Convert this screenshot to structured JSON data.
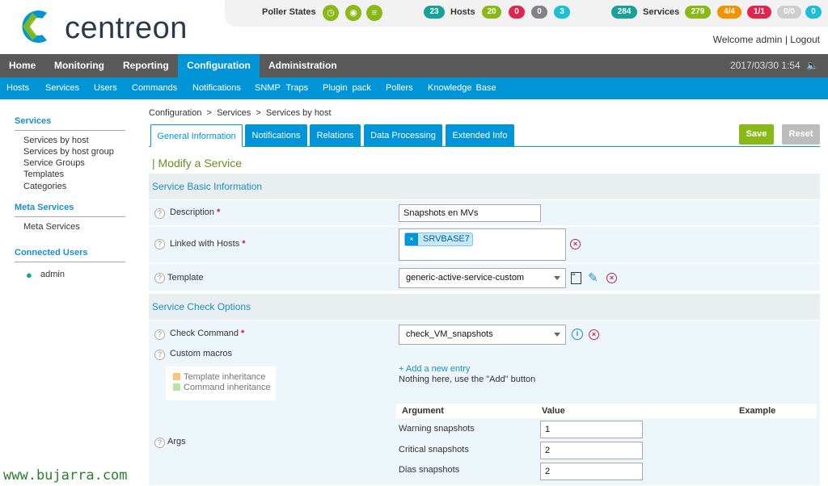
{
  "brand": {
    "logo_text": "centreon"
  },
  "status": {
    "poller_label": "Poller States",
    "hosts": {
      "total": "23",
      "label": "Hosts",
      "up": "20",
      "down": "0",
      "unreachable": "0",
      "pending": "3"
    },
    "services": {
      "total": "284",
      "label": "Services",
      "ok": "279",
      "warning": "4/4",
      "critical": "1/1",
      "unknown": "0/0",
      "pending": "0"
    }
  },
  "user": {
    "welcome": "Welcome admin",
    "separator": "|",
    "logout": "Logout"
  },
  "nav": {
    "items": [
      "Home",
      "Monitoring",
      "Reporting",
      "Configuration",
      "Administration"
    ],
    "clock": "2017/03/30 1:54"
  },
  "subnav": {
    "items": [
      "Hosts",
      "Services",
      "Users",
      "Commands",
      "Notifications",
      "SNMP Traps",
      "Plugin pack",
      "Pollers",
      "Knowledge Base"
    ]
  },
  "sidebar": {
    "services_title": "Services",
    "services_items": [
      "Services by host",
      "Services by host group",
      "Service Groups",
      "Templates",
      "Categories"
    ],
    "meta_title": "Meta Services",
    "meta_items": [
      "Meta Services"
    ],
    "connected_title": "Connected Users",
    "connected_users": [
      "admin"
    ]
  },
  "breadcrumb": "Configuration  >  Services  >  Services by host",
  "form_tabs": [
    "General Information",
    "Notifications",
    "Relations",
    "Data Processing",
    "Extended Info"
  ],
  "buttons": {
    "save": "Save",
    "reset": "Reset"
  },
  "page_title": "| Modify a Service",
  "sections": {
    "basic": "Service Basic Information",
    "check": "Service Check Options"
  },
  "fields": {
    "description": {
      "label": "Description",
      "value": "Snapshots en MVs"
    },
    "linked_hosts": {
      "label": "Linked with Hosts",
      "tag": "SRVBASE7"
    },
    "template": {
      "label": "Template",
      "value": "generic-active-service-custom"
    },
    "check_command": {
      "label": "Check Command",
      "value": "check_VM_snapshots"
    },
    "custom_macros": {
      "label": "Custom macros",
      "legend_template": "Template inheritance",
      "legend_command": "Command inheritance",
      "add_entry": "+ Add a new entry",
      "empty_note": "Nothing here, use the \"Add\" button"
    },
    "args": {
      "label": "Args",
      "headers": [
        "Argument",
        "Value",
        "Example"
      ],
      "rows": [
        {
          "argument": "Warning snapshots",
          "value": "1"
        },
        {
          "argument": "Critical snapshots",
          "value": "2"
        },
        {
          "argument": "Dias snapshots",
          "value": "2"
        }
      ]
    }
  },
  "watermark": "www.bujarra.com",
  "colors": {
    "accent": "#0095d7",
    "ok": "#88b917",
    "critical": "#e2244f",
    "warning": "#f39200",
    "teal": "#17a199",
    "nav": "#595959"
  }
}
